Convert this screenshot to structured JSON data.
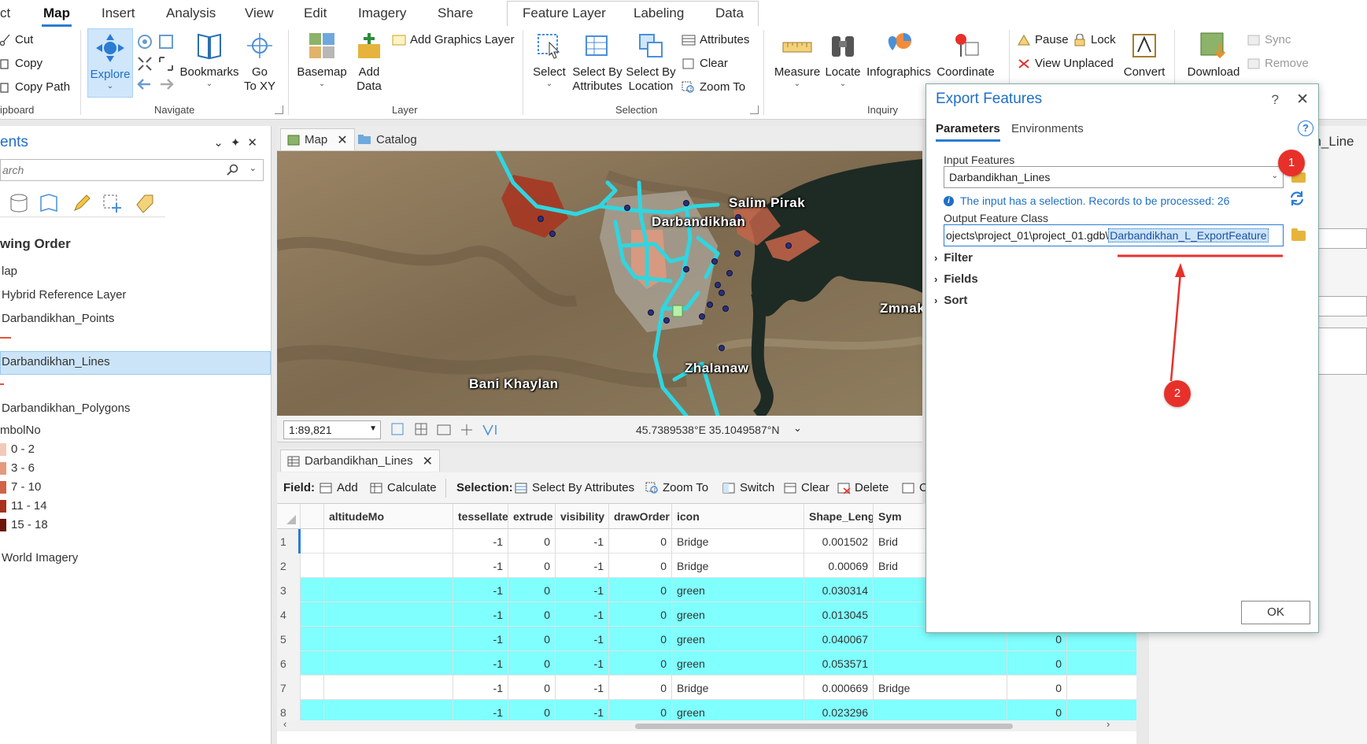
{
  "ribbon": {
    "tabs": [
      "ct",
      "Map",
      "Insert",
      "Analysis",
      "View",
      "Edit",
      "Imagery",
      "Share",
      "Feature Layer",
      "Labeling",
      "Data"
    ],
    "active_tab": "Map",
    "clipboard": {
      "cut": "Cut",
      "copy": "Copy",
      "copy_path": "Copy Path",
      "label": "ipboard"
    },
    "navigate": {
      "explore": "Explore",
      "bookmarks": "Bookmarks",
      "go_to_xy_1": "Go",
      "go_to_xy_2": "To XY",
      "label": "Navigate"
    },
    "layer": {
      "basemap": "Basemap",
      "add_data_1": "Add",
      "add_data_2": "Data",
      "add_graphics": "Add Graphics Layer",
      "label": "Layer"
    },
    "selection": {
      "select": "Select",
      "select_attr_1": "Select By",
      "select_attr_2": "Attributes",
      "select_loc_1": "Select By",
      "select_loc_2": "Location",
      "attributes": "Attributes",
      "clear": "Clear",
      "zoom_to": "Zoom To",
      "label": "Selection"
    },
    "inquiry": {
      "measure": "Measure",
      "locate": "Locate",
      "infographics": "Infographics",
      "coordinate": "Coordinate",
      "label": "Inquiry"
    },
    "labeling": {
      "pause": "Pause",
      "lock": "Lock",
      "view_unplaced": "View Unplaced",
      "convert": "Convert"
    },
    "offline": {
      "download": "Download",
      "sync": "Sync",
      "remove": "Remove"
    }
  },
  "contents": {
    "title": "ents",
    "search_placeholder": "arch",
    "drawing_order": "wing Order",
    "items": {
      "map": "lap",
      "hybrid": "Hybrid Reference Layer",
      "points": "Darbandikhan_Points",
      "lines": "Darbandikhan_Lines",
      "polygons": "Darbandikhan_Polygons",
      "symbol_field": "mbolNo",
      "imagery": "World Imagery"
    },
    "legend": [
      {
        "label": "0 - 2",
        "color": "#f3c9b8"
      },
      {
        "label": "3 - 6",
        "color": "#e59a7e"
      },
      {
        "label": "7 - 10",
        "color": "#cf6448"
      },
      {
        "label": "11 - 14",
        "color": "#a8321e"
      },
      {
        "label": "15 - 18",
        "color": "#6e1409"
      }
    ]
  },
  "view_tabs": {
    "map": "Map",
    "catalog": "Catalog"
  },
  "map": {
    "labels": [
      "Salim Pirak",
      "Darbandikhan",
      "Zmnako",
      "Zhalanaw",
      "Bani Khaylan"
    ],
    "scale": "1:89,821",
    "coordinates": "45.7389538°E 35.1049587°N",
    "line_color": "#2fd6e0",
    "polygon_color": "#a8321e"
  },
  "table": {
    "tab_title": "Darbandikhan_Lines",
    "toolbar": {
      "field_label": "Field:",
      "add": "Add",
      "calculate": "Calculate",
      "selection_label": "Selection:",
      "select_by_attributes": "Select By Attributes",
      "zoom_to": "Zoom To",
      "switch": "Switch",
      "clear": "Clear",
      "delete": "Delete",
      "copy": "C"
    },
    "columns": [
      "altitudeMo",
      "tessellate",
      "extrude",
      "visibility",
      "drawOrder",
      "icon",
      "Shape_Leng",
      "Sym"
    ],
    "rows": [
      {
        "n": "1",
        "tessellate": "-1",
        "extrude": "0",
        "visibility": "-1",
        "drawOrder": "0",
        "icon": "Bridge",
        "shape": "0.001502",
        "sym": "Brid",
        "extra": "",
        "sel": false
      },
      {
        "n": "2",
        "tessellate": "-1",
        "extrude": "0",
        "visibility": "-1",
        "drawOrder": "0",
        "icon": "Bridge",
        "shape": "0.00069",
        "sym": "Brid",
        "extra": "",
        "sel": false
      },
      {
        "n": "3",
        "tessellate": "-1",
        "extrude": "0",
        "visibility": "-1",
        "drawOrder": "0",
        "icon": "green",
        "shape": "0.030314",
        "sym": "",
        "extra": "",
        "sel": true
      },
      {
        "n": "4",
        "tessellate": "-1",
        "extrude": "0",
        "visibility": "-1",
        "drawOrder": "0",
        "icon": "green",
        "shape": "0.013045",
        "sym": "",
        "extra": "",
        "sel": true
      },
      {
        "n": "5",
        "tessellate": "-1",
        "extrude": "0",
        "visibility": "-1",
        "drawOrder": "0",
        "icon": "green",
        "shape": "0.040067",
        "sym": "",
        "extra": "0",
        "sel": true
      },
      {
        "n": "6",
        "tessellate": "-1",
        "extrude": "0",
        "visibility": "-1",
        "drawOrder": "0",
        "icon": "green",
        "shape": "0.053571",
        "sym": "",
        "extra": "0",
        "sel": true
      },
      {
        "n": "7",
        "tessellate": "-1",
        "extrude": "0",
        "visibility": "-1",
        "drawOrder": "0",
        "icon": "Bridge",
        "shape": "0.000669",
        "sym": "Bridge",
        "extra": "0",
        "sel": false
      },
      {
        "n": "8",
        "tessellate": "-1",
        "extrude": "0",
        "visibility": "-1",
        "drawOrder": "0",
        "icon": "green",
        "shape": "0.023296",
        "sym": "",
        "extra": "0",
        "sel": true
      }
    ]
  },
  "right_pane": {
    "partial_label": "an_Line"
  },
  "dialog": {
    "title": "Export Features",
    "help": "?",
    "tabs": {
      "parameters": "Parameters",
      "environments": "Environments"
    },
    "input_label": "Input Features",
    "input_value": "Darbandikhan_Lines",
    "info": "The input has a selection. Records to be processed: 26",
    "output_label": "Output Feature Class",
    "output_prefix": "ojects\\project_01\\project_01.gdb\\",
    "output_highlight": "Darbandikhan_L_ExportFeature",
    "sections": {
      "filter": "Filter",
      "fields": "Fields",
      "sort": "Sort"
    },
    "ok": "OK"
  },
  "annotations": {
    "badge_1": "1",
    "badge_2": "2",
    "annotation_color": "#e8302a"
  }
}
